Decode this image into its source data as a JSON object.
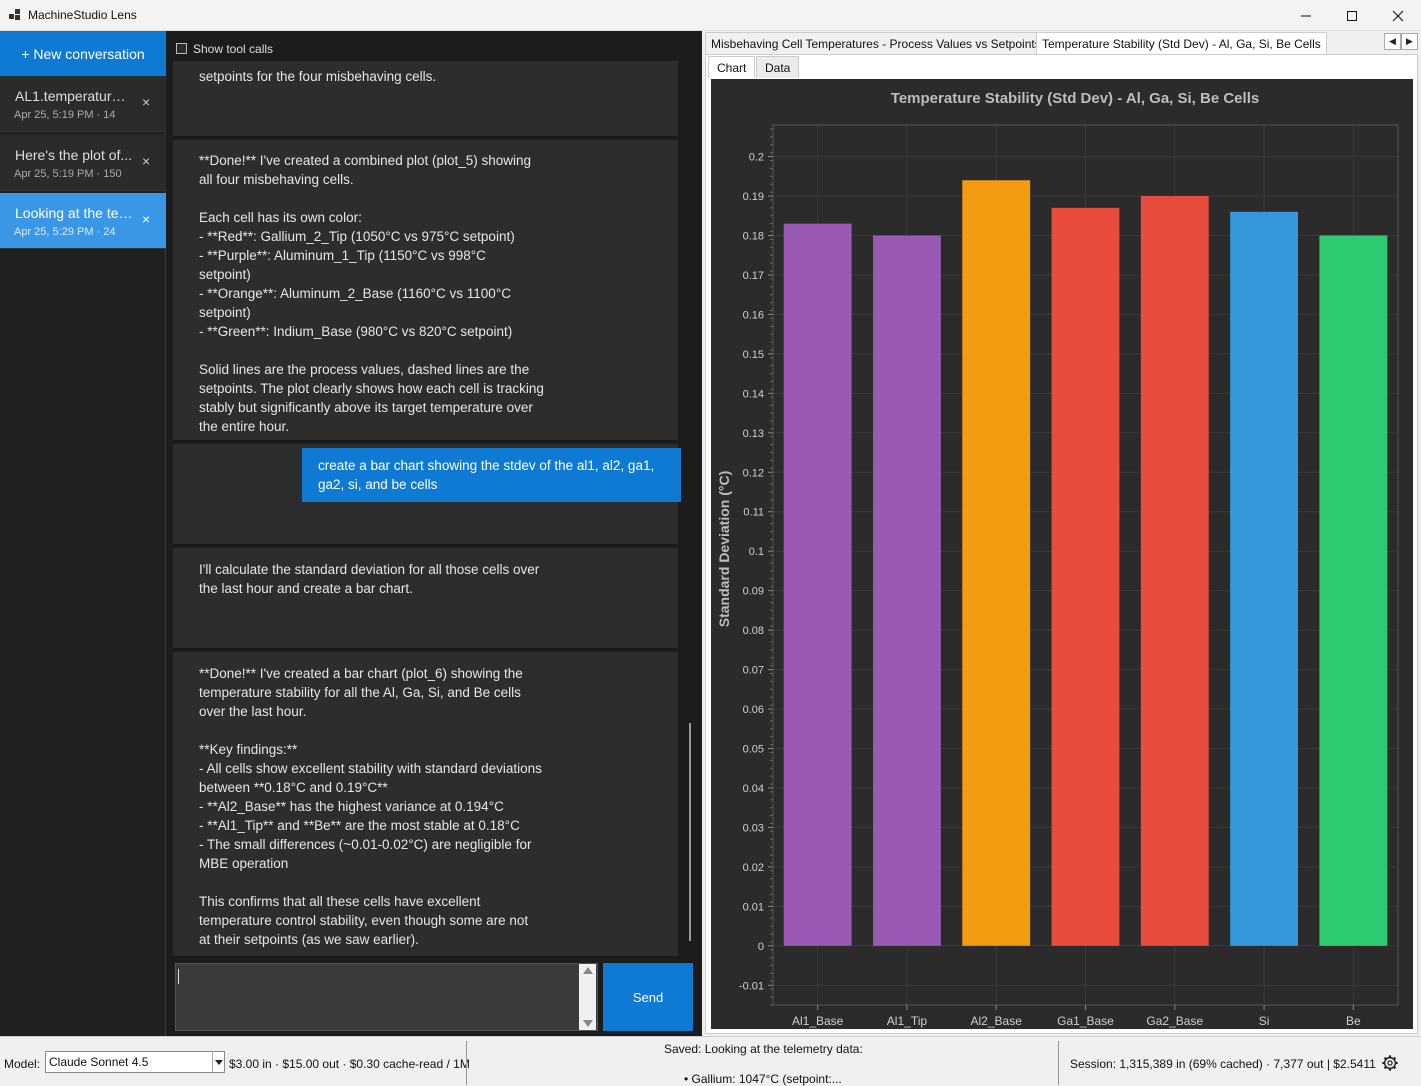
{
  "window": {
    "title": "MachineStudio Lens"
  },
  "sidebar": {
    "new_conversation": "+ New conversation",
    "conversations": [
      {
        "title": "AL1.temperature....",
        "meta": "Apr 25, 5:19 PM  ·  14",
        "active": false
      },
      {
        "title": "Here's the plot of...",
        "meta": "Apr 25, 5:19 PM  ·  150",
        "active": false
      },
      {
        "title": "Looking at the tel...",
        "meta": "Apr 25, 5:29 PM  ·  24",
        "active": true
      }
    ],
    "close_glyph": "×"
  },
  "chat": {
    "show_tool_calls": "Show tool calls",
    "messages": [
      {
        "role": "assistant",
        "text": "setpoints for the four misbehaving cells."
      },
      {
        "role": "assistant",
        "text": "**Done!** I've created a combined plot (plot_5) showing\nall four misbehaving cells.\n\nEach cell has its own color:\n- **Red**: Gallium_2_Tip (1050°C vs 975°C setpoint)\n- **Purple**: Aluminum_1_Tip (1150°C vs 998°C\nsetpoint)\n- **Orange**: Aluminum_2_Base (1160°C vs 1100°C\nsetpoint)\n- **Green**: Indium_Base (980°C vs 820°C setpoint)\n\nSolid lines are the process values, dashed lines are the\nsetpoints. The plot clearly shows how each cell is tracking\nstably but significantly above its target temperature over\nthe entire hour."
      },
      {
        "role": "user",
        "text": "create a bar chart showing the stdev of the al1, al2, ga1,\nga2, si, and be cells"
      },
      {
        "role": "assistant",
        "text": "I'll calculate the standard deviation for all those cells over\nthe last hour and create a bar chart."
      },
      {
        "role": "assistant",
        "text": "**Done!** I've created a bar chart (plot_6) showing the\ntemperature stability for all the Al, Ga, Si, and Be cells\nover the last hour.\n\n**Key findings:**\n- All cells show excellent stability with standard deviations\nbetween **0.18°C and 0.19°C**\n- **Al2_Base** has the highest variance at 0.194°C\n- **Al1_Tip** and **Be** are the most stable at 0.18°C\n- The small differences (~0.01-0.02°C) are negligible for\nMBE operation\n\nThis confirms that all these cells have excellent\ntemperature control stability, even though some are not\nat their setpoints (as we saw earlier)."
      }
    ],
    "input_value": "",
    "send_label": "Send"
  },
  "plots": {
    "tabs": [
      "Misbehaving Cell Temperatures - Process Values vs Setpoints",
      "Temperature Stability (Std Dev) - Al, Ga, Si, Be Cells"
    ],
    "active_tab": 1,
    "nav_prev": "◀",
    "nav_next": "▶",
    "subtabs": [
      "Chart",
      "Data"
    ],
    "active_subtab": 0
  },
  "chart_data": {
    "type": "bar",
    "title": "Temperature Stability (Std Dev) - Al, Ga, Si, Be Cells",
    "xlabel": "",
    "ylabel": "Standard Deviation (°C)",
    "categories": [
      "Al1_Base",
      "Al1_Tip",
      "Al2_Base",
      "Ga1_Base",
      "Ga2_Base",
      "Si",
      "Be"
    ],
    "values": [
      0.183,
      0.18,
      0.194,
      0.187,
      0.19,
      0.186,
      0.18
    ],
    "colors": [
      "#9b59b6",
      "#9b59b6",
      "#f39c12",
      "#e74c3c",
      "#e74c3c",
      "#3498db",
      "#2ecc71"
    ],
    "ylim": [
      -0.015,
      0.208
    ],
    "yticks": [
      -0.01,
      0,
      0.01,
      0.02,
      0.03,
      0.04,
      0.05,
      0.06,
      0.07,
      0.08,
      0.09,
      0.1,
      0.11,
      0.12,
      0.13,
      0.14,
      0.15,
      0.16,
      0.17,
      0.18,
      0.19,
      0.2
    ],
    "grid": true,
    "background": "#2b2b2b"
  },
  "status": {
    "model_label": "Model:",
    "model_value": "Claude Sonnet 4.5",
    "pricing": "$3.00 in · $15.00 out · $0.30 cache-read / 1M",
    "saved_line1": "Saved: Looking at the telemetry data:",
    "saved_line2": "• Gallium: 1047°C (setpoint:...",
    "session": "Session: 1,315,389 in (69% cached) · 7,377 out  |  $2.5411"
  }
}
